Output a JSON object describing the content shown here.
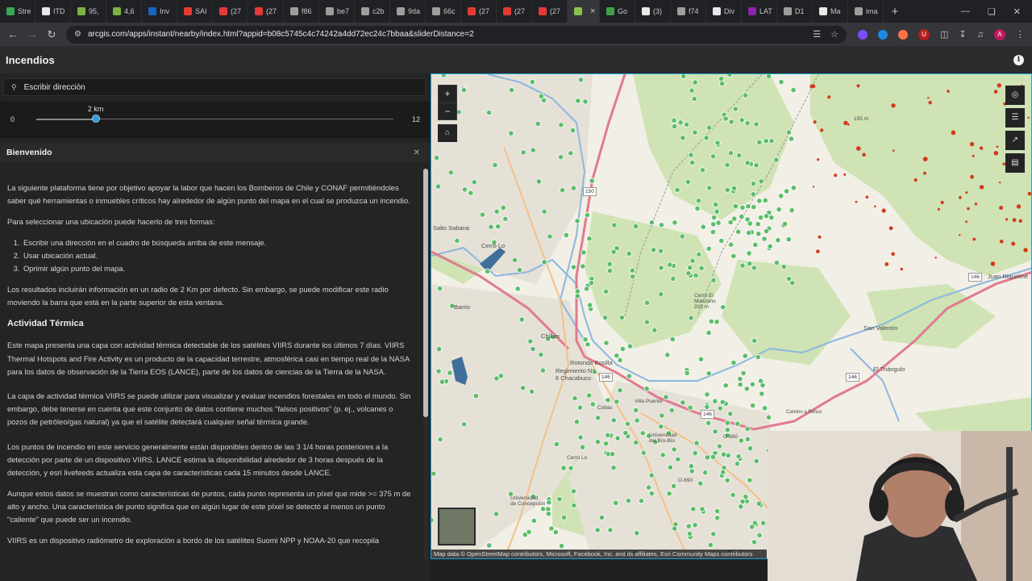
{
  "browser": {
    "tabs": [
      {
        "label": "Stre",
        "color": "#34a853"
      },
      {
        "label": "ITD",
        "color": "#e8e8e8"
      },
      {
        "label": "95,",
        "color": "#7cb342"
      },
      {
        "label": "4,6",
        "color": "#7cb342"
      },
      {
        "label": "Inv",
        "color": "#1565c0"
      },
      {
        "label": "SAI",
        "color": "#e53935"
      },
      {
        "label": "(27",
        "color": "#e53935"
      },
      {
        "label": "(27",
        "color": "#e53935"
      },
      {
        "label": "f86",
        "color": "#9e9e9e"
      },
      {
        "label": "be7",
        "color": "#9e9e9e"
      },
      {
        "label": "c2b",
        "color": "#9e9e9e"
      },
      {
        "label": "9da",
        "color": "#9e9e9e"
      },
      {
        "label": "66c",
        "color": "#9e9e9e"
      },
      {
        "label": "(27",
        "color": "#e53935"
      },
      {
        "label": "(27",
        "color": "#e53935"
      },
      {
        "label": "(27",
        "color": "#e53935"
      },
      {
        "label": "",
        "color": "#8bc34a"
      },
      {
        "label": "Go",
        "color": "#43a047"
      },
      {
        "label": "(3)",
        "color": "#e8e8e8"
      },
      {
        "label": "f74",
        "color": "#9e9e9e"
      },
      {
        "label": "Div",
        "color": "#e8e8e8"
      },
      {
        "label": "LAT",
        "color": "#8e24aa"
      },
      {
        "label": "D1",
        "color": "#9e9e9e"
      },
      {
        "label": "Ma",
        "color": "#e8e8e8"
      },
      {
        "label": "ima",
        "color": "#9e9e9e"
      }
    ],
    "active_tab_index": 16,
    "url": "arcgis.com/apps/instant/nearby/index.html?appid=b08c5745c4c74242a4dd72ec24c7bbaa&sliderDistance=2",
    "avatar_letter": "A",
    "ext_badge": "U"
  },
  "app": {
    "title": "Incendios"
  },
  "search": {
    "placeholder": "Escribir dirección"
  },
  "slider": {
    "value_label": "2 km",
    "min": "0",
    "max": "12",
    "value": 2,
    "min_value": 0,
    "max_value": 12
  },
  "welcome": {
    "title": "Bienvenido",
    "p1": "La siguiente plataforma tiene por objetivo apoyar la labor que hacen los Bomberos de Chile y CONAF permitiéndoles saber qué herramientas o inmuebles críticos hay alrededor de algún punto del mapa en el cual se produzca un incendio.",
    "p2": "Para seleccionar una ubicación puede hacerlo de tres formas:",
    "list": [
      "Escribir una dirección en el cuadro de búsqueda arriba de este mensaje.",
      "Usar ubicación actual.",
      "Oprimir algún punto del mapa."
    ],
    "p3": "Los resultados incluirán información en un radio de 2 Km por defecto. Sin embargo, se puede modificar este radio moviendo la barra que está en la parte superior de esta ventana.",
    "h_thermal": "Actividad Térmica",
    "p4": "Este mapa presenta una capa con actividad térmica detectable de los satélites VIIRS durante los últimos 7 días. VIIRS Thermal Hotspots and Fire Activity es un producto de la capacidad terrestre, atmosférica casi en tiempo real de la NASA para los datos de observación de la Tierra EOS (LANCE), parte de los datos de ciencias de la Tierra de la NASA.",
    "p5": "La capa de actividad térmica VIIRS se puede utilizar para visualizar y evaluar incendios forestales en todo el mundo. Sin embargo, debe tenerse en cuenta que este conjunto de datos contiene muchos \"falsos positivos\" (p. ej., volcanes o pozos de petróleo/gas natural) ya que el satélite detectará cualquier señal térmica grande.",
    "p6": "Los puntos de incendio en este servicio generalmente están disponibles dentro de las 3 1/4 horas posteriores a la detección por parte de un dispositivo VIIRS. LANCE estima la disponibilidad alrededor de 3 horas después de la detección, y esri livefeeds actualiza esta capa de características cada 15 minutos desde LANCE.",
    "p7": "Aunque estos datos se muestran como características de puntos, cada punto representa un píxel que mide >= 375 m de alto y ancho. Una característica de punto significa que en algún lugar de este píxel se detectó al menos un punto \"caliente\" que puede ser un incendio.",
    "p8": "VIIRS es un dispositivo radiómetro de exploración a bordo de los satélites Suomi NPP y NOAA-20 que recopila"
  },
  "map": {
    "attribution": "Map data © OpenStreetMap contributors, Microsoft, Facebook, Inc. and its affiliates, Esri Community Maps contributors",
    "labels": {
      "salto_sabana": "Salto\nSabana",
      "cerro_lo": "Cerro Lo",
      "barrio": "Barrio",
      "chillan": "Chillán",
      "rotonda": "Rotonda Bosilla",
      "regimiento": "Regimiento N°\n6 Chacabuco",
      "cerro_manzano": "Cerro El\nManzano\n203 m",
      "san_valentin": "San Valentín",
      "el_triangulo": "El Triángulo",
      "juan_riquelme": "Juan Riquelme",
      "universidad_biobio": "Universidad\ndel Bío-Bío",
      "universidad_concepcion": "Universidad\nde Concepción",
      "villa_puente": "Villa Puente",
      "elev_155": "155 m",
      "cerro_lo2": "Cerro Lo",
      "collao": "Collao",
      "camino": "Camino a Penco",
      "o690": "O-690",
      "o690b": "O-690"
    },
    "road_numbers": [
      "150",
      "146",
      "146",
      "146",
      "146"
    ]
  }
}
